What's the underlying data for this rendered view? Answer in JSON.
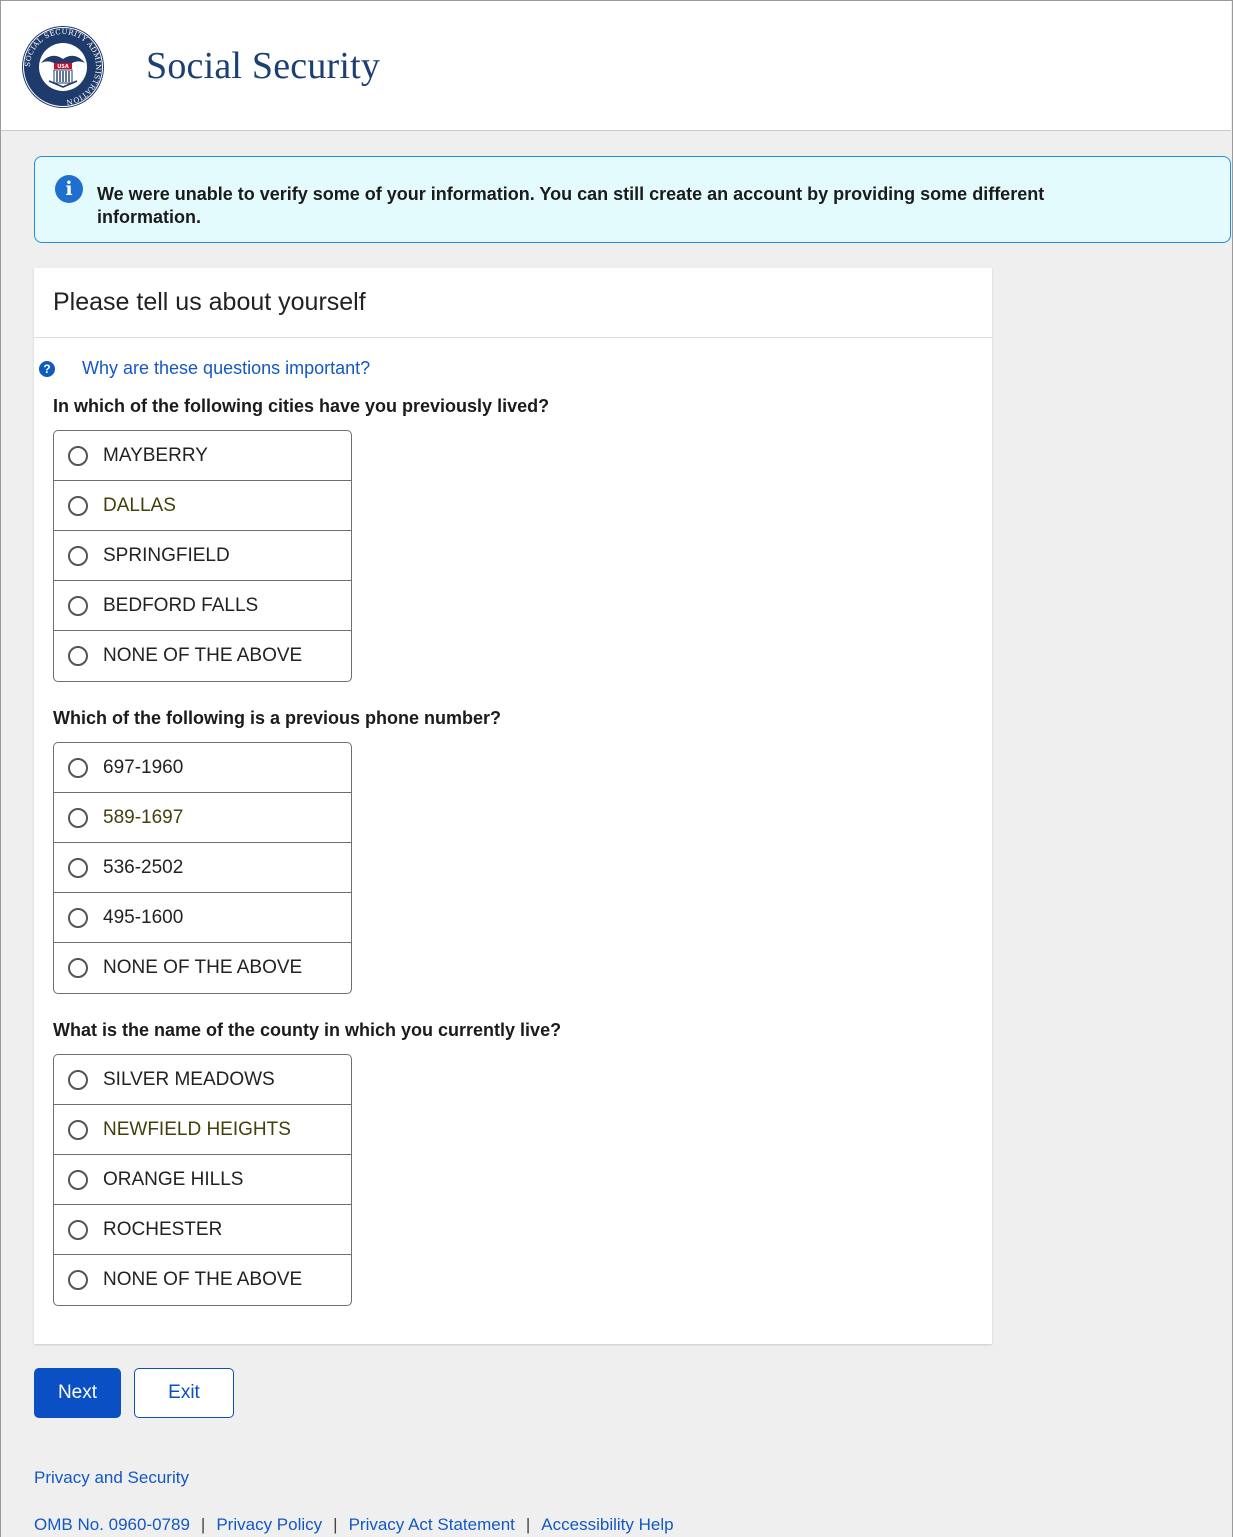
{
  "header": {
    "title": "Social Security",
    "logo": {
      "icon": "ssa-seal-icon",
      "ring_text": "SOCIAL SECURITY ADMINISTRATION",
      "center_text": "USA"
    }
  },
  "alert": {
    "icon": "info-icon",
    "text": "We were unable to verify some of your information. You can still create an account by providing some different information."
  },
  "panel": {
    "title": "Please tell us about yourself",
    "help_icon": "question-circle-icon",
    "help_link": "Why are these questions important?",
    "questions": [
      {
        "text": "In which of the following cities have you previously lived?",
        "options": [
          "MAYBERRY",
          "DALLAS",
          "SPRINGFIELD",
          "BEDFORD FALLS",
          "NONE OF THE ABOVE"
        ]
      },
      {
        "text": "Which of the following is a previous phone number?",
        "options": [
          "697-1960",
          "589-1697",
          "536-2502",
          "495-1600",
          "NONE OF THE ABOVE"
        ]
      },
      {
        "text": "What is the name of the county in which you currently live?",
        "options": [
          "SILVER MEADOWS",
          "NEWFIELD HEIGHTS",
          "ORANGE HILLS",
          "ROCHESTER",
          "NONE OF THE ABOVE"
        ]
      }
    ]
  },
  "actions": {
    "next_label": "Next",
    "exit_label": "Exit"
  },
  "footer": {
    "privacy_security": "Privacy and Security",
    "omb": "OMB No. 0960-0789",
    "separator": "|",
    "privacy_policy": "Privacy Policy",
    "privacy_act": "Privacy Act Statement",
    "accessibility": "Accessibility Help"
  },
  "colors": {
    "brand_navy": "#1c3f74",
    "primary_blue": "#0b4fc5",
    "link_blue": "#1358c4",
    "alert_bg": "#e3fbfd",
    "alert_border": "#2a8bd6",
    "page_bg": "#efefef"
  }
}
